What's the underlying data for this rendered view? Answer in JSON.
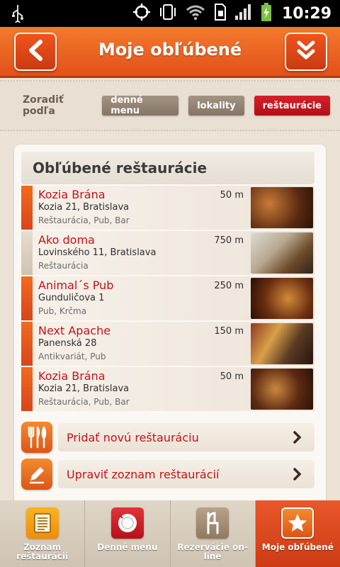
{
  "status_bar": {
    "time": "10:29"
  },
  "header": {
    "title": "Moje obľúbené"
  },
  "sort": {
    "label": "Zoradiť podľa",
    "options": [
      "denné menu",
      "lokality",
      "reštaurácie"
    ],
    "active": "reštaurácie"
  },
  "section": {
    "title": "Obľúbené reštaurácie"
  },
  "restaurants": [
    {
      "name": "Kozia Brána",
      "address": "Kozia 21, Bratislava",
      "tags": "Reštaurácia, Pub, Bar",
      "distance": "50 m"
    },
    {
      "name": "Ako doma",
      "address": "Lovinského 11, Bratislava",
      "tags": "Reštaurácia",
      "distance": "750 m"
    },
    {
      "name": "Animal´s Pub",
      "address": "Gunduličova 1",
      "tags": "Pub, Krčma",
      "distance": "250 m"
    },
    {
      "name": "Next Apache",
      "address": "Panenská 28",
      "tags": "Antikvariát, Pub",
      "distance": "150 m"
    },
    {
      "name": "Kozia Brána",
      "address": "Kozia 21, Bratislava",
      "tags": "Reštaurácia, Pub, Bar",
      "distance": "50 m"
    }
  ],
  "actions": {
    "add": "Pridať novú reštauráciu",
    "edit": "Upraviť zoznam reštaurácií"
  },
  "bottom_nav": [
    {
      "label": "Zoznam reštaurácií",
      "icon": "list-icon"
    },
    {
      "label": "Denné menu",
      "icon": "plate-icon"
    },
    {
      "label": "Rezervácie on-line",
      "icon": "chair-icon"
    },
    {
      "label": "Moje obľúbené",
      "icon": "star-icon",
      "active": true
    }
  ],
  "colors": {
    "accent": "#e2511a",
    "active_chip": "#c4121a",
    "link_red": "#c4121a"
  }
}
